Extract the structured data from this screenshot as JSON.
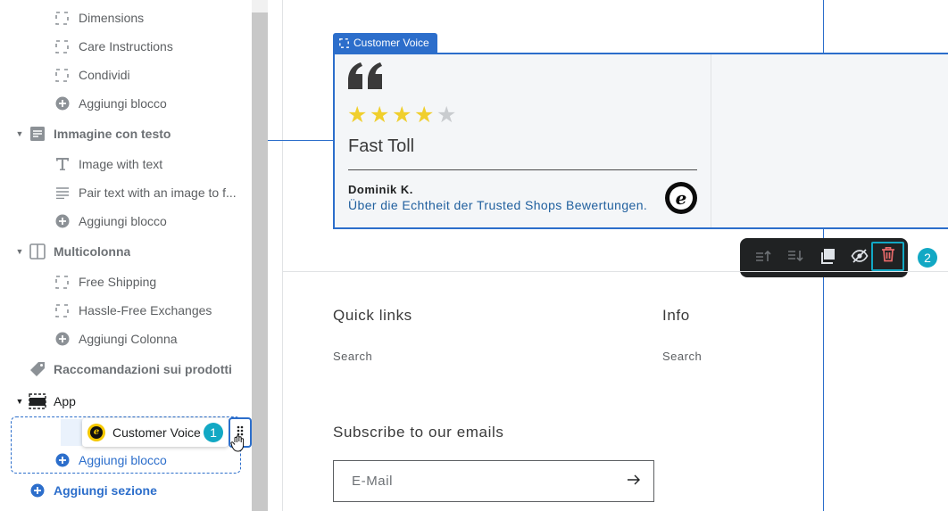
{
  "sidebar": {
    "rows": [
      {
        "label": "Dimensions",
        "icon": "dashed-square-icon"
      },
      {
        "label": "Care Instructions",
        "icon": "dashed-square-icon"
      },
      {
        "label": "Condividi",
        "icon": "dashed-square-icon"
      },
      {
        "label": "Aggiungi blocco",
        "icon": "plus-circle-icon"
      },
      {
        "label": "Immagine con testo",
        "icon": "image-text-section-icon"
      },
      {
        "label": "Image with text",
        "icon": "text-t-icon"
      },
      {
        "label": "Pair text with an image to f...",
        "icon": "paragraph-lines-icon"
      },
      {
        "label": "Aggiungi blocco",
        "icon": "plus-circle-icon"
      },
      {
        "label": "Multicolonna",
        "icon": "columns-section-icon"
      },
      {
        "label": "Free Shipping",
        "icon": "dashed-square-icon"
      },
      {
        "label": "Hassle-Free Exchanges",
        "icon": "dashed-square-icon"
      },
      {
        "label": "Aggiungi Colonna",
        "icon": "plus-circle-icon"
      },
      {
        "label": "Raccomandazioni sui prodotti",
        "icon": "tag-icon"
      },
      {
        "label": "App",
        "icon": "app-section-icon"
      }
    ],
    "dragged_block": {
      "label": "Customer Voice",
      "step_badge": "1"
    },
    "add_block_label": "Aggiungi blocco",
    "add_section_label": "Aggiungi sezione"
  },
  "preview": {
    "block_tag": "Customer Voice",
    "review": {
      "rating": 4,
      "max_rating": 5,
      "title": "Fast Toll",
      "author": "Dominik K.",
      "trust_link": "Über die Echtheit der Trusted Shops Bewertungen."
    },
    "toolbar": {
      "buttons": [
        "move-up-icon",
        "move-down-icon",
        "duplicate-icon",
        "hide-icon",
        "delete-icon"
      ],
      "step_badge": "2"
    },
    "footer": {
      "quick_links_heading": "Quick links",
      "quick_links_item": "Search",
      "info_heading": "Info",
      "info_item": "Search",
      "subscribe_heading": "Subscribe to our emails",
      "email_placeholder": "E-Mail"
    }
  },
  "colors": {
    "accent": "#2c6ecb",
    "step_badge": "#12a8c4",
    "star": "#f0cf2d",
    "star_empty": "#c9cccf",
    "delete": "#e86a6a"
  }
}
